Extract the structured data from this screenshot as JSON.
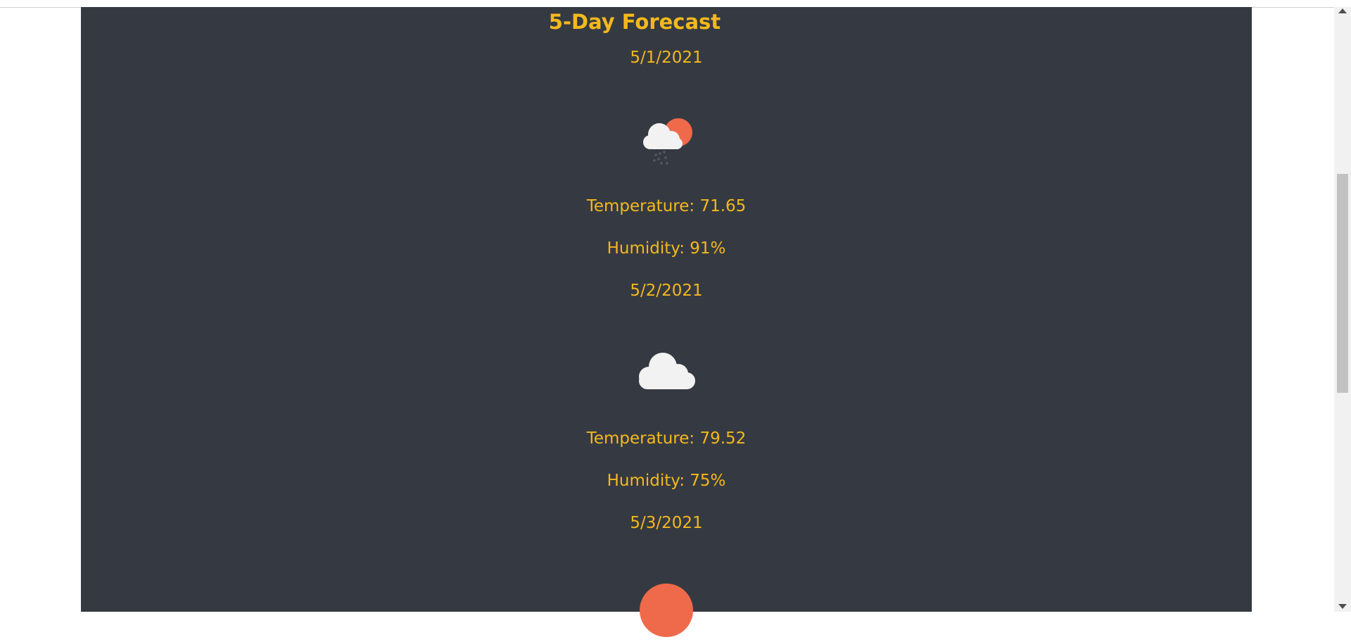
{
  "forecast": {
    "title": "5-Day Forecast",
    "days": [
      {
        "date": "5/1/2021",
        "icon": "rain-cloud-sun-icon",
        "temperature": "Temperature: 71.65",
        "humidity": "Humidity: 91%"
      },
      {
        "date": "5/2/2021",
        "icon": "cloud-icon",
        "temperature": "Temperature: 79.52",
        "humidity": "Humidity: 75%"
      },
      {
        "date": "5/3/2021",
        "icon": "sun-icon"
      }
    ]
  },
  "colors": {
    "panel_bg": "#353a42",
    "accent_text": "#f5b81c",
    "sun": "#ef6a4a",
    "cloud": "#f2f2f2"
  }
}
